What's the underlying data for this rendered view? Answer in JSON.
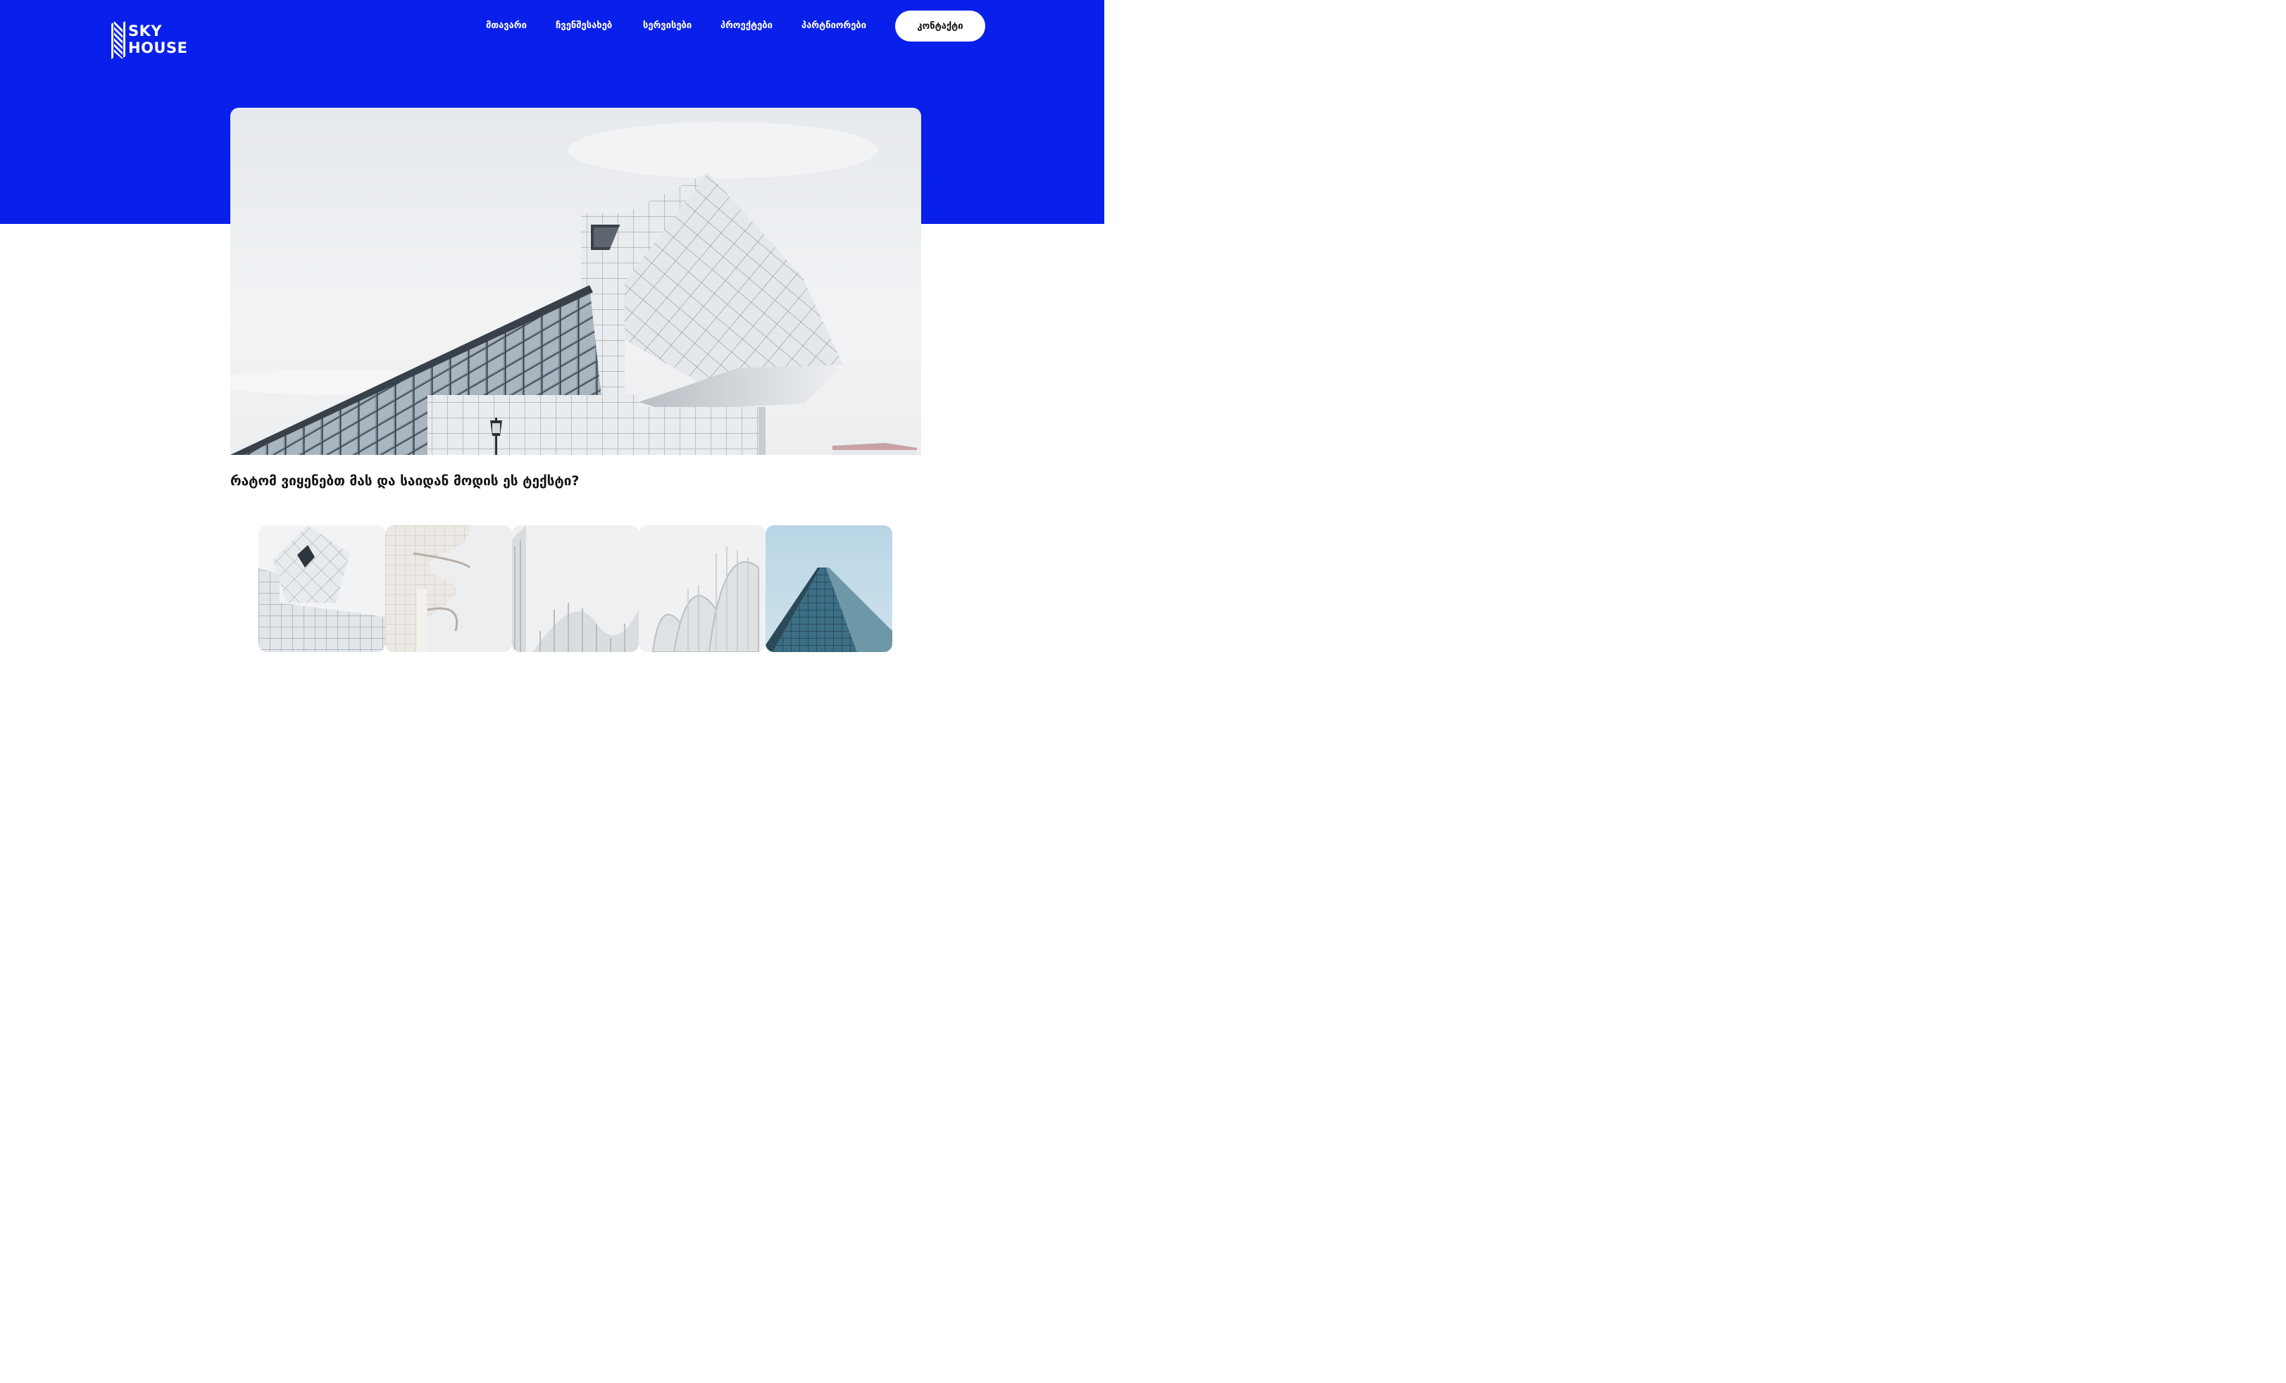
{
  "brand": {
    "line1": "SKY",
    "line2": "HOUSE",
    "logo_icon": "building-stripes-icon"
  },
  "nav": {
    "items": [
      {
        "label": "მთავარი"
      },
      {
        "label": "ჩვენშესახებ"
      },
      {
        "label": "სერვისები"
      },
      {
        "label": "პროექტები"
      },
      {
        "label": "პარტნიორები"
      }
    ],
    "contact_label": "კონტაქტი"
  },
  "colors": {
    "brand_blue": "#0920EA",
    "white": "#FFFFFF",
    "text_dark": "#111111"
  },
  "article": {
    "title": "რატომ ვიყენებთ მას და საიდან მოდის ეს ტექსტი?"
  },
  "gallery": {
    "items": [
      {
        "name": "gallery-image-tile-building"
      },
      {
        "name": "gallery-image-curved-facade"
      },
      {
        "name": "gallery-image-white-fins"
      },
      {
        "name": "gallery-image-white-arches"
      },
      {
        "name": "gallery-image-glass-tower"
      }
    ]
  }
}
